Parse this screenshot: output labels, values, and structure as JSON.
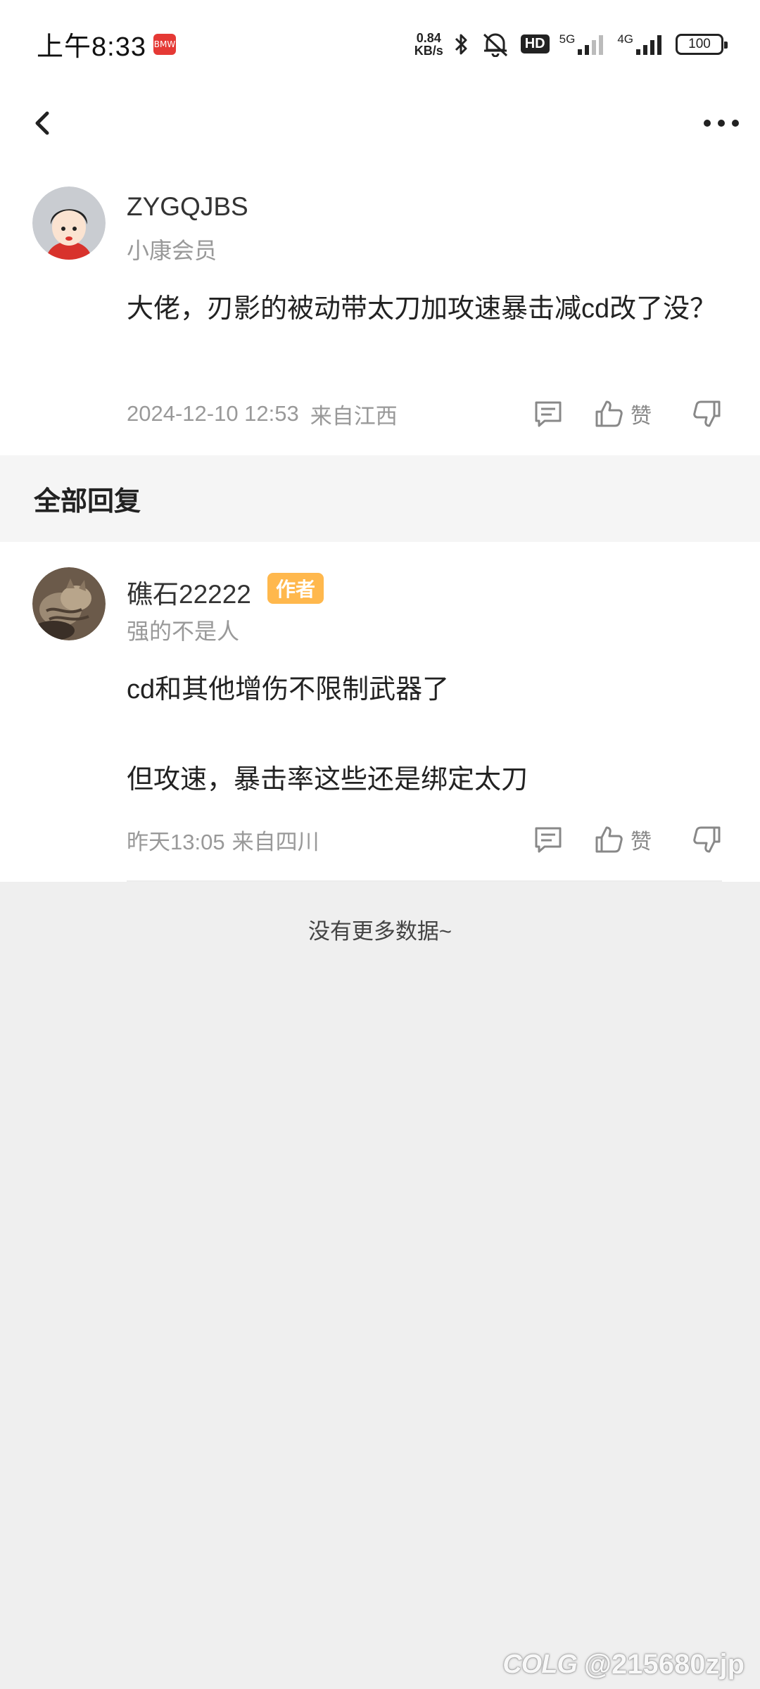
{
  "status_bar": {
    "time": "上午8:33",
    "app_badge": "BMW",
    "net_speed_value": "0.84",
    "net_speed_unit": "KB/s",
    "hd": "HD",
    "signal1_label": "5G",
    "signal2_label": "4G",
    "battery": "100"
  },
  "post": {
    "user_name": "ZYGQJBS",
    "user_level": "小康会员",
    "content": "大佬，刃影的被动带太刀加攻速暴击减cd改了没？",
    "timestamp": "2024-12-10 12:53",
    "location": "来自江西",
    "like_label": "赞"
  },
  "section": {
    "title": "全部回复"
  },
  "reply": {
    "user_name": "礁石22222",
    "author_tag": "作者",
    "user_sub": "强的不是人",
    "line1": "cd和其他增伤不限制武器了",
    "line2": "但攻速，暴击率这些还是绑定太刀",
    "timestamp": "昨天13:05",
    "location": "来自四川",
    "like_label": "赞"
  },
  "footer": {
    "no_more": "没有更多数据~"
  },
  "watermark": {
    "logo": "COLG",
    "handle": "@215680zjp"
  }
}
